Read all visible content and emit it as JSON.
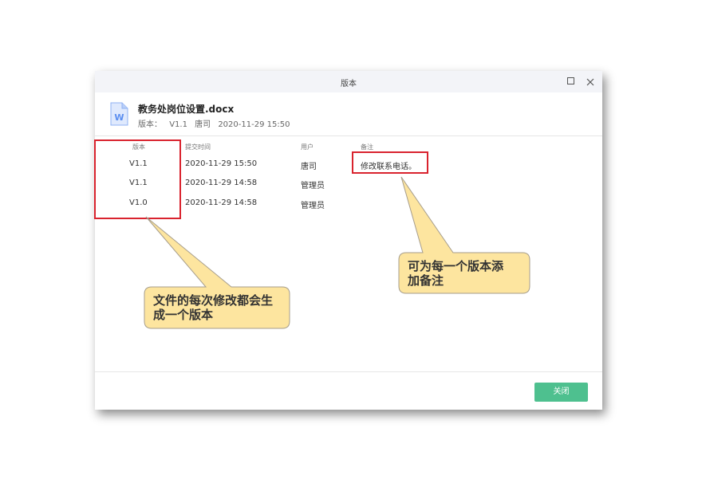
{
  "dialog": {
    "title": "版本",
    "file_name": "教务处岗位设置.docx",
    "meta": {
      "label": "版本：",
      "version": "V1.1",
      "user": "唐司",
      "time": "2020-11-29 15:50"
    }
  },
  "table": {
    "columns": [
      "版本",
      "提交时间",
      "用户",
      "备注"
    ],
    "rows": [
      {
        "version": "V1.1",
        "time": "2020-11-29 15:50",
        "user": "唐司",
        "note": "修改联系电话。"
      },
      {
        "version": "V1.1",
        "time": "2020-11-29 14:58",
        "user": "管理员",
        "note": ""
      },
      {
        "version": "V1.0",
        "time": "2020-11-29 14:58",
        "user": "管理员",
        "note": ""
      }
    ]
  },
  "footer": {
    "close_label": "关闭"
  },
  "callouts": {
    "left_line1": "文件的每次修改都会生",
    "left_line2": "成一个版本",
    "right_line1": "可为每一个版本添",
    "right_line2": "加备注"
  },
  "colors": {
    "accent_button": "#4ec08f",
    "highlight_border": "#d9232e",
    "callout_fill": "#fde59f",
    "word_icon": "#5b8ef0"
  },
  "icons": {
    "file": "word-document-icon",
    "maximize": "maximize-icon",
    "close": "close-icon"
  }
}
